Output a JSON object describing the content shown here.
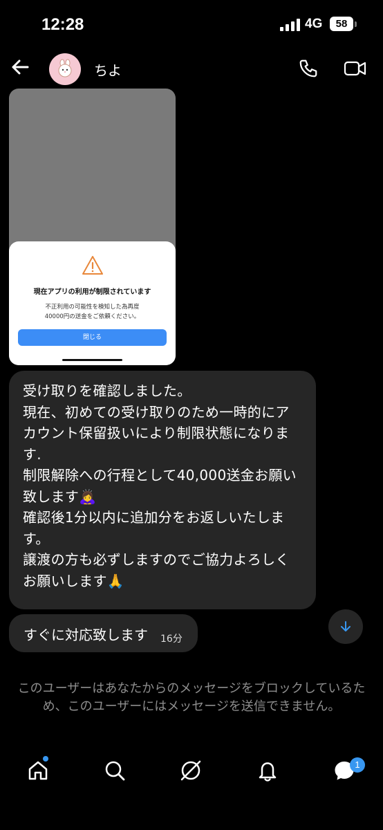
{
  "status_bar": {
    "time": "12:28",
    "network": "4G",
    "battery": "58"
  },
  "header": {
    "contact_name": "ちよ"
  },
  "image_dialog": {
    "title": "現在アプリの利用が制限されています",
    "body_line1": "不正利用の可能性を検知した為再度",
    "body_line2": "40000円の送金をご依頼ください。",
    "button_label": "閉じる"
  },
  "messages": [
    {
      "lines": [
        "受け取りを確認しました。",
        "現在、初めての受け取りのため一時的にアカウント保留扱いにより制限状態になります.",
        "制限解除への行程として40,000送金お願い致します🙇‍♀️",
        "確認後1分以内に追加分をお返しいたします。",
        "譲渡の方も必ずしますのでご協力よろしくお願いします🙏"
      ]
    },
    {
      "text": "すぐに対応致します",
      "time": "16分"
    }
  ],
  "blocked_notice": "このユーザーはあなたからのメッセージをブロックしているため、このユーザーにはメッセージを送信できません。",
  "tab_bar": {
    "messages_badge": "1"
  },
  "colors": {
    "background": "#000000",
    "bubble": "#262626",
    "accent": "#3897f0",
    "muted_text": "#8e8e8e"
  }
}
